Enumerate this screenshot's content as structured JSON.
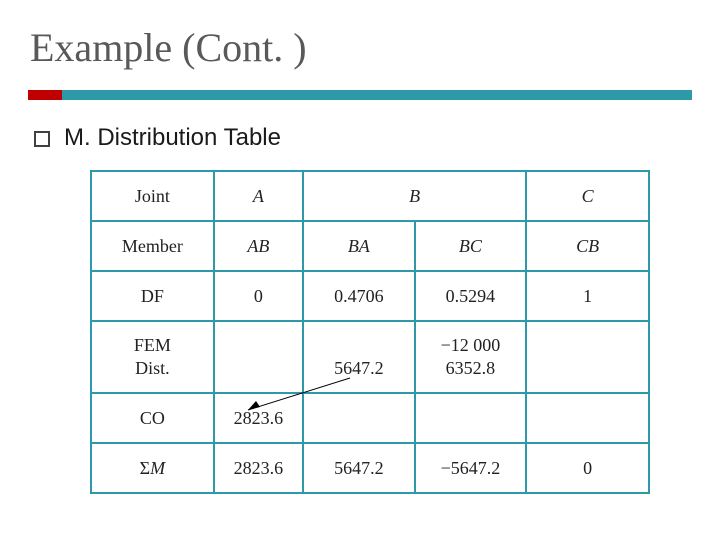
{
  "title": "Example (Cont. )",
  "bullet": "M. Distribution Table",
  "chart_data": {
    "type": "table",
    "rows": [
      {
        "label": "Joint",
        "cells": [
          "A",
          "B",
          "C"
        ]
      },
      {
        "label": "Member",
        "cells": [
          "AB",
          "BA",
          "BC",
          "CB"
        ]
      },
      {
        "label": "DF",
        "cells": [
          "0",
          "0.4706",
          "0.5294",
          "1"
        ]
      },
      {
        "label_a": "FEM",
        "label_b": "Dist.",
        "cells": {
          "1b": "5647.2",
          "2a": "−12 000",
          "2b": "6352.8"
        }
      },
      {
        "label": "CO",
        "cells": [
          "2823.6",
          "",
          "",
          ""
        ]
      },
      {
        "label_sym": "M",
        "cells": [
          "2823.6",
          "5647.2",
          "−5647.2",
          "0"
        ]
      }
    ]
  }
}
